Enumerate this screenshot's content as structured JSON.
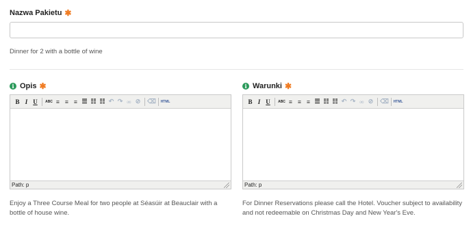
{
  "package_name": {
    "label": "Nazwa Pakietu",
    "required_mark": "✱",
    "value": "",
    "hint": "Dinner for 2 with a bottle of wine"
  },
  "description": {
    "label": "Opis",
    "required_mark": "✱",
    "info_icon": "info-icon",
    "status": "Path: p",
    "hint": "Enjoy a Three Course Meal for two people at Séasúir at Beauclair with a bottle of house wine."
  },
  "terms": {
    "label": "Warunki",
    "required_mark": "✱",
    "info_icon": "info-icon",
    "status": "Path: p",
    "hint": "For Dinner Reservations please call the Hotel. Voucher subject to availability and not redeemable on Christmas Day and New Year's Eve."
  },
  "toolbar": {
    "bold": "B",
    "italic": "I",
    "underline": "U",
    "strike": "ABC",
    "html": "HTML"
  },
  "colors": {
    "required": "#f07c23",
    "info": "#2b9a5b"
  }
}
